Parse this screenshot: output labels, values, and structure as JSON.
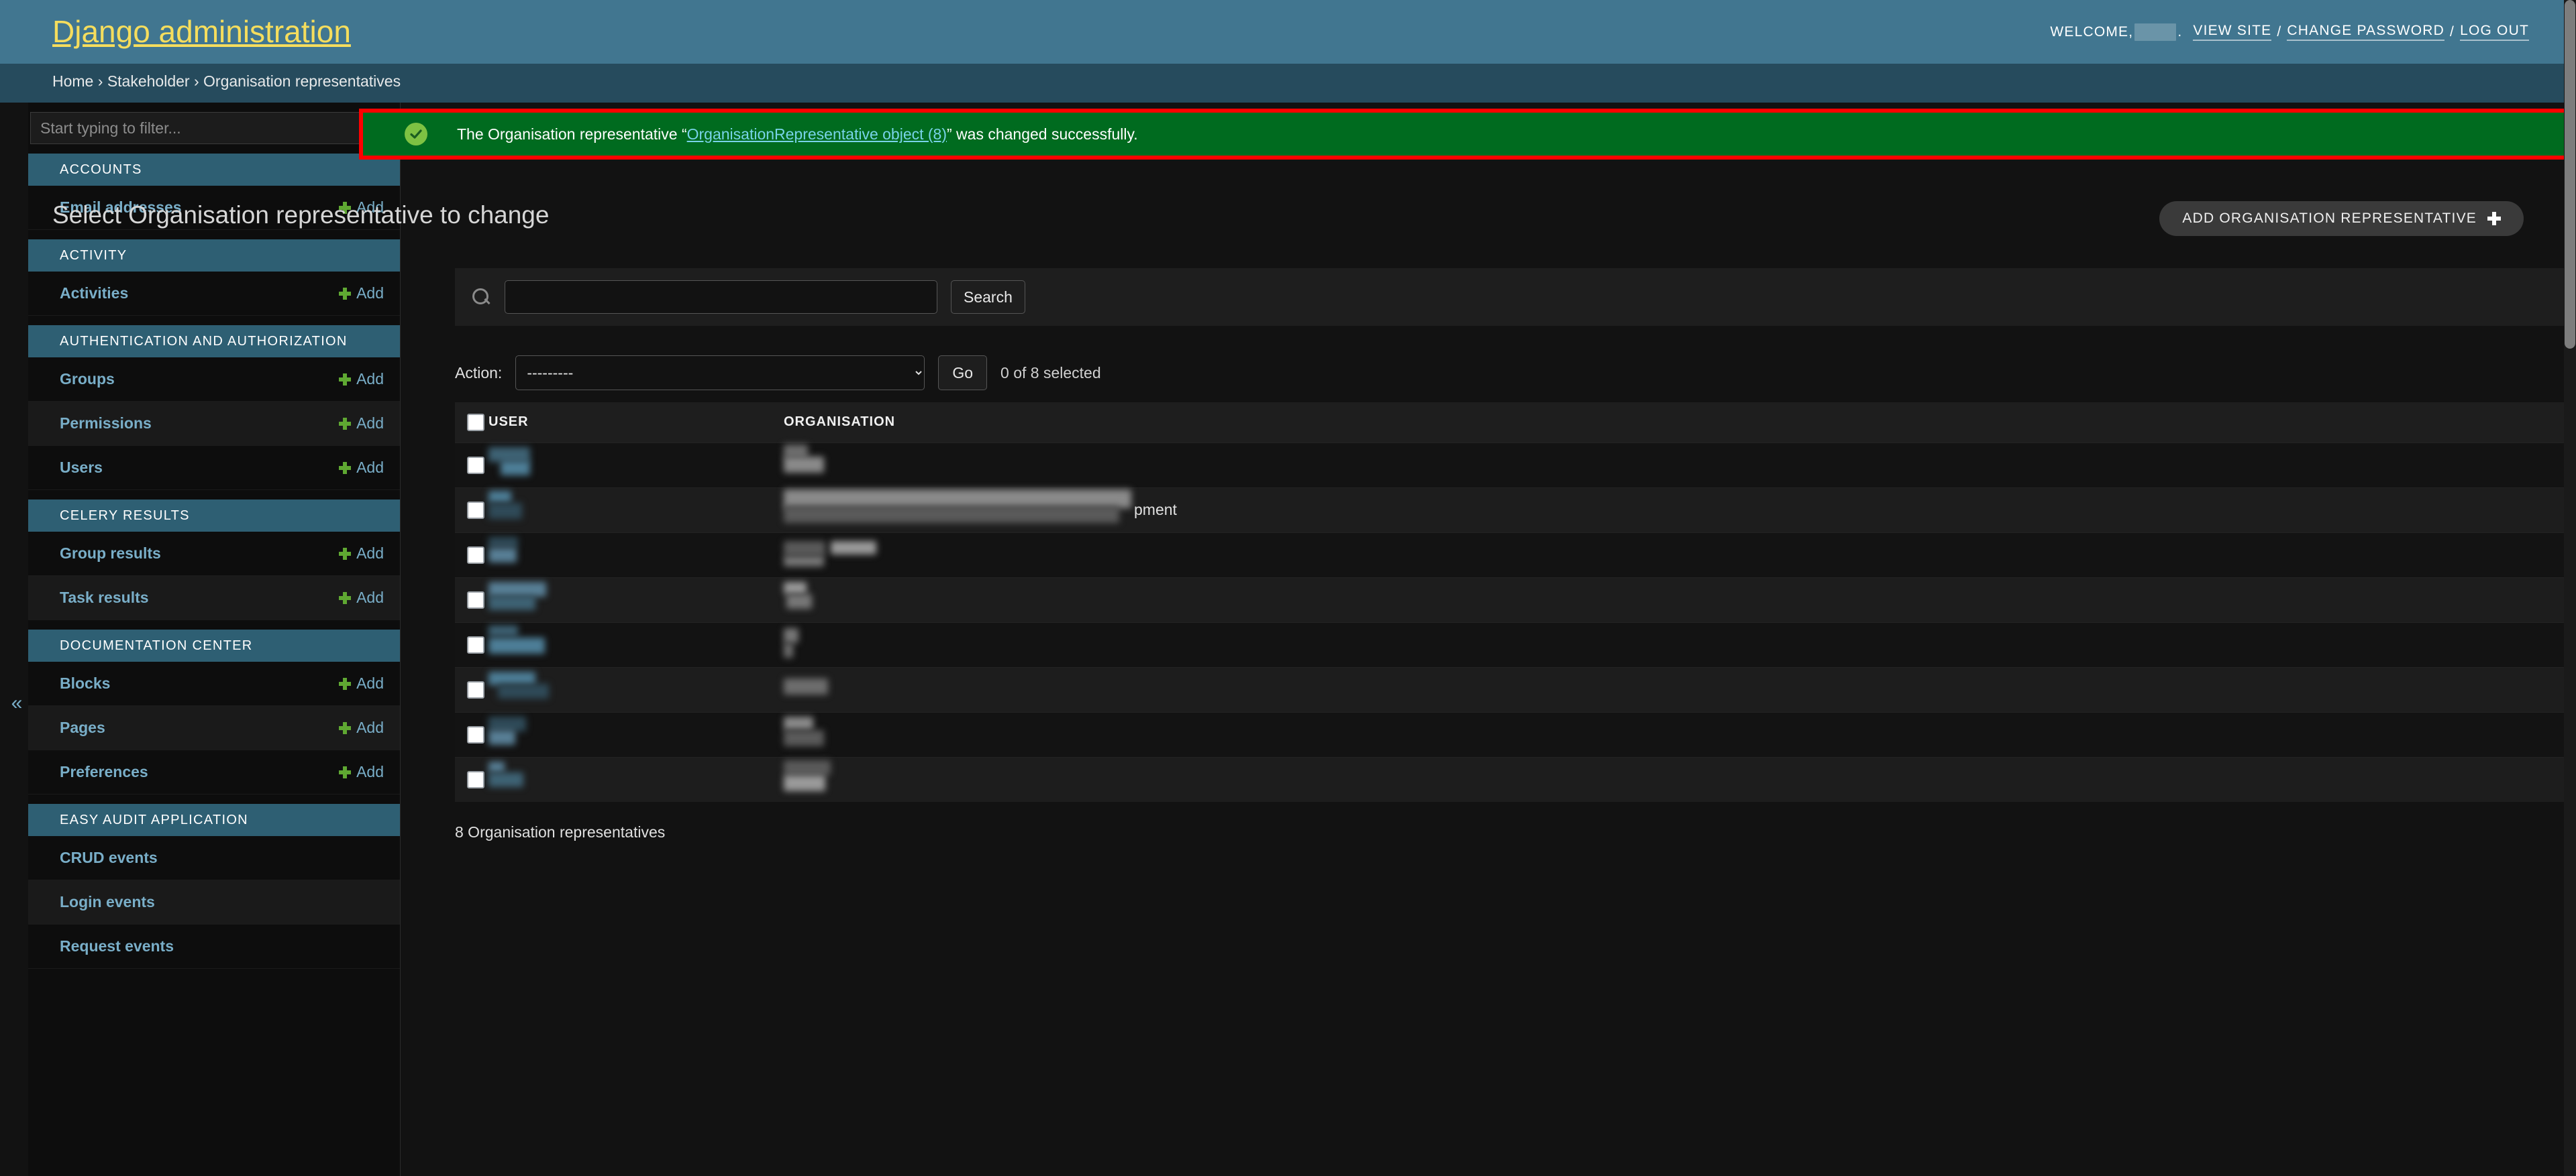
{
  "header": {
    "site_title": "Django administration",
    "welcome_label": "WELCOME,",
    "username_redacted": "",
    "view_site": "VIEW SITE",
    "change_password": "CHANGE PASSWORD",
    "log_out": "LOG OUT",
    "sep": "/"
  },
  "breadcrumbs": {
    "home": "Home",
    "sep1": "›",
    "app": "Stakeholder",
    "sep2": "›",
    "model": "Organisation representatives"
  },
  "sidebar": {
    "filter_placeholder": "Start typing to filter...",
    "filter_value": "",
    "collapse_icon": "«",
    "add_label": "Add",
    "modules": [
      {
        "caption": "ACCOUNTS",
        "rows": [
          {
            "label": "Email addresses",
            "add": "Add",
            "has_add": true
          }
        ]
      },
      {
        "caption": "ACTIVITY",
        "rows": [
          {
            "label": "Activities",
            "add": "Add",
            "has_add": true
          }
        ]
      },
      {
        "caption": "AUTHENTICATION AND AUTHORIZATION",
        "rows": [
          {
            "label": "Groups",
            "add": "Add",
            "has_add": true
          },
          {
            "label": "Permissions",
            "add": "Add",
            "has_add": true
          },
          {
            "label": "Users",
            "add": "Add",
            "has_add": true
          }
        ]
      },
      {
        "caption": "CELERY RESULTS",
        "rows": [
          {
            "label": "Group results",
            "add": "Add",
            "has_add": true
          },
          {
            "label": "Task results",
            "add": "Add",
            "has_add": true
          }
        ]
      },
      {
        "caption": "DOCUMENTATION CENTER",
        "rows": [
          {
            "label": "Blocks",
            "add": "Add",
            "has_add": true
          },
          {
            "label": "Pages",
            "add": "Add",
            "has_add": true
          },
          {
            "label": "Preferences",
            "add": "Add",
            "has_add": true
          }
        ]
      },
      {
        "caption": "EASY AUDIT APPLICATION",
        "rows": [
          {
            "label": "CRUD events",
            "add": "",
            "has_add": false
          },
          {
            "label": "Login events",
            "add": "",
            "has_add": false
          },
          {
            "label": "Request events",
            "add": "",
            "has_add": false
          }
        ]
      }
    ]
  },
  "message": {
    "icon": "check-circle-icon",
    "prefix": "The Organisation representative “",
    "object_link": "OrganisationRepresentative object (8)",
    "suffix": "” was changed successfully.",
    "background_color": "#006b1f",
    "highlight_color": "#ff0000"
  },
  "main": {
    "page_title": "Select Organisation representative to change",
    "add_button": "ADD ORGANISATION REPRESENTATIVE",
    "search": {
      "value": "",
      "placeholder": "",
      "submit_label": "Search"
    },
    "actions": {
      "label": "Action:",
      "selected": "---------",
      "options": [
        "---------"
      ],
      "go_label": "Go",
      "counter": "0 of 8 selected"
    },
    "table": {
      "columns": [
        "USER",
        "ORGANISATION"
      ],
      "rows": [
        {
          "user": "",
          "organisation": "",
          "org_tail": "",
          "redacted": true
        },
        {
          "user": "",
          "organisation": "",
          "org_tail": "pment",
          "redacted": true
        },
        {
          "user": "",
          "organisation": "",
          "org_tail": "",
          "redacted": true
        },
        {
          "user": "",
          "organisation": "",
          "org_tail": "",
          "redacted": true
        },
        {
          "user": "",
          "organisation": "",
          "org_tail": "",
          "redacted": true
        },
        {
          "user": "",
          "organisation": "",
          "org_tail": "",
          "redacted": true
        },
        {
          "user": "",
          "organisation": "",
          "org_tail": "",
          "redacted": true
        },
        {
          "user": "",
          "organisation": "",
          "org_tail": "",
          "redacted": true
        }
      ]
    },
    "paginator": "8 Organisation representatives"
  },
  "theme": {
    "header_bg": "#417690",
    "breadcrumb_bg": "#264b5d",
    "accent_title": "#f5dd5d",
    "link_blue": "#79aec8",
    "module_caption_bg": "#2e5f73",
    "content_bg": "#121212"
  }
}
